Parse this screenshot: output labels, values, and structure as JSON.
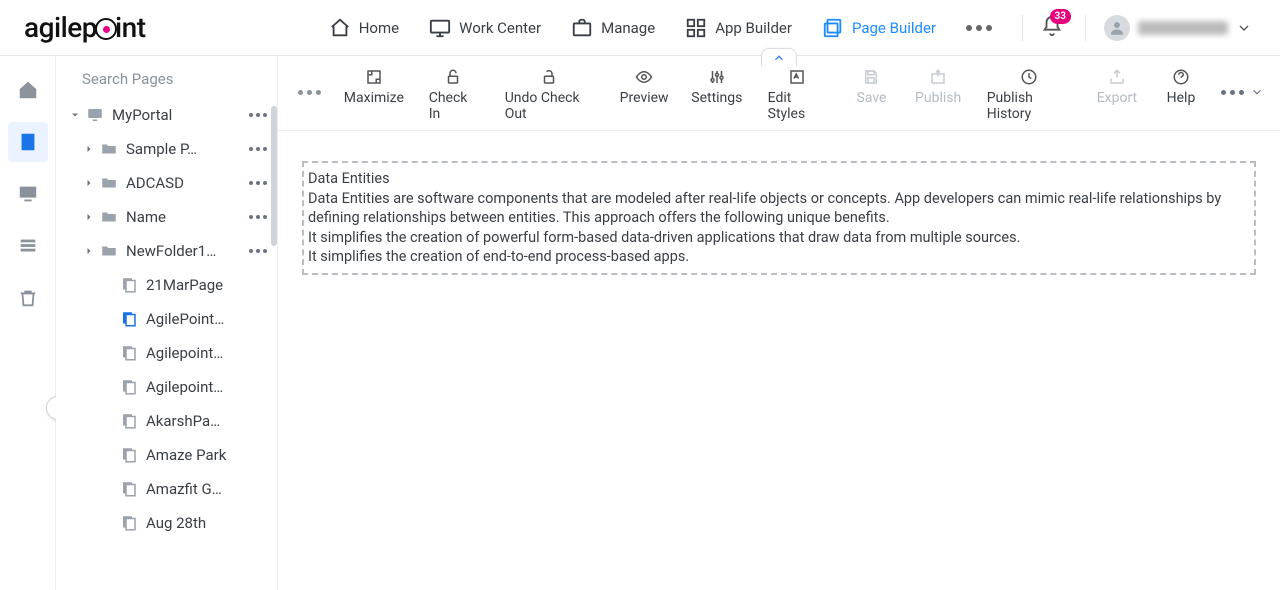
{
  "brand": "agilepoint",
  "topnav": {
    "home": "Home",
    "work_center": "Work Center",
    "manage": "Manage",
    "app_builder": "App Builder",
    "page_builder": "Page Builder"
  },
  "notifications": {
    "count": "33"
  },
  "sidebar": {
    "search_placeholder": "Search Pages",
    "root": {
      "label": "MyPortal"
    },
    "folders": [
      {
        "label": "Sample P…"
      },
      {
        "label": "ADCASD"
      },
      {
        "label": "Name"
      },
      {
        "label": "NewFolder1…"
      }
    ],
    "pages": [
      {
        "label": "21MarPage"
      },
      {
        "label": "AgilePoint…",
        "selected": true
      },
      {
        "label": "Agilepoint…"
      },
      {
        "label": "Agilepoint…"
      },
      {
        "label": "AkarshPa…"
      },
      {
        "label": "Amaze Park"
      },
      {
        "label": "Amazfit G…"
      },
      {
        "label": "Aug 28th"
      }
    ]
  },
  "toolbar": {
    "maximize": "Maximize",
    "check_in": "Check In",
    "undo_check_out": "Undo Check Out",
    "preview": "Preview",
    "settings": "Settings",
    "edit_styles": "Edit Styles",
    "save": "Save",
    "publish": "Publish",
    "publish_history": "Publish History",
    "export": "Export",
    "help": "Help"
  },
  "content": {
    "title": "Data Entities",
    "line1": "Data Entities are software components that are modeled after real-life objects or concepts. App developers can mimic real-life relationships by defining relationships between entities. This approach offers the following unique benefits.",
    "line2": "It simplifies the creation of powerful form-based data-driven applications that draw data from multiple sources.",
    "line3": "It simplifies the creation of end-to-end process-based apps."
  }
}
